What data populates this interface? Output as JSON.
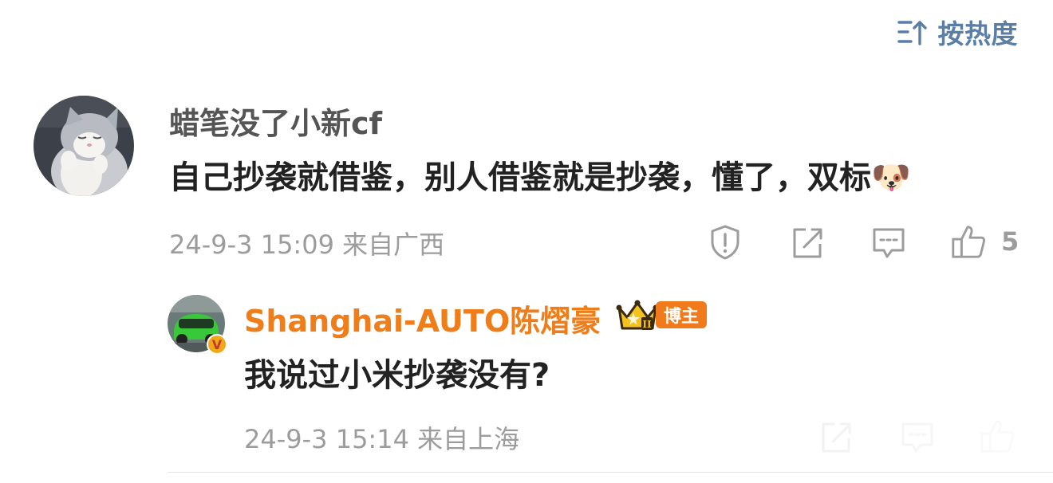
{
  "sort": {
    "label": "按热度",
    "icon": "sort-icon"
  },
  "comment": {
    "username": "蜡笔没了小新cf",
    "text": "自己抄袭就借鉴，别人借鉴就是抄袭，懂了，双标🐶",
    "timestamp": "24-9-3 15:09",
    "location": "来自广西",
    "meta": "24-9-3 15:09  来自广西",
    "likes": "5",
    "avatar": "cat-avatar"
  },
  "reply": {
    "username": "Shanghai-AUTO陈熠豪",
    "badge": "博主",
    "crown_level": "II",
    "verified": "V",
    "text": "我说过小米抄袭没有?",
    "timestamp": "24-9-3 15:14",
    "location": "来自上海",
    "meta": "24-9-3 15:14  来自上海",
    "avatar": "green-car-avatar"
  },
  "colors": {
    "accent_blue": "#5b7ea6",
    "blogger_orange": "#ef7d1a",
    "meta_gray": "#9c9c9c",
    "text_dark": "#222222"
  }
}
